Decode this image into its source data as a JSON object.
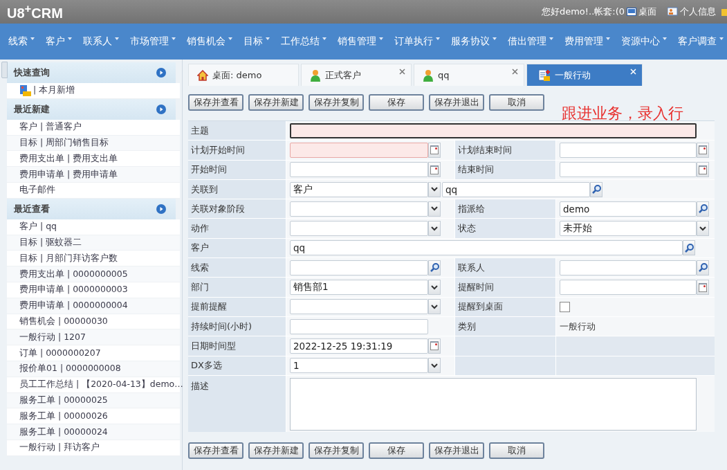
{
  "header": {
    "logo": "U8$^{+}$CRM",
    "greeting": "您好demo!..帐套:(0",
    "desktop_link": "桌面",
    "profile_link": "个人信息"
  },
  "nav": [
    "线索",
    "客户",
    "联系人",
    "市场管理",
    "销售机会",
    "目标",
    "工作总结",
    "销售管理",
    "订单执行",
    "服务协议",
    "借出管理",
    "费用管理",
    "资源中心",
    "客户调查"
  ],
  "sidebar": {
    "sections": [
      {
        "title": "快速查询",
        "items": [
          {
            "label": "| 本月新增",
            "kind": "icon"
          }
        ]
      },
      {
        "title": "最近新建",
        "items": [
          {
            "label": "客户 | 普通客户",
            "kind": "plain"
          },
          {
            "label": "目标 | 周部门销售目标",
            "kind": "plain"
          },
          {
            "label": "费用支出单 | 费用支出单",
            "kind": "plain"
          },
          {
            "label": "费用申请单 | 费用申请单",
            "kind": "plain"
          },
          {
            "label": "电子邮件",
            "kind": "plain"
          }
        ]
      },
      {
        "title": "最近查看",
        "items": [
          {
            "label": "客户 | qq",
            "kind": "plain"
          },
          {
            "label": "目标 | 驱蚊器二",
            "kind": "plain"
          },
          {
            "label": "目标 | 月部门拜访客户数",
            "kind": "plain"
          },
          {
            "label": "费用支出单 | 0000000005",
            "kind": "plain"
          },
          {
            "label": "费用申请单 | 0000000003",
            "kind": "plain"
          },
          {
            "label": "费用申请单 | 0000000004",
            "kind": "plain"
          },
          {
            "label": "销售机会 | 00000030",
            "kind": "plain"
          },
          {
            "label": "一般行动 | 1207",
            "kind": "plain"
          },
          {
            "label": "订单 | 0000000207",
            "kind": "plain"
          },
          {
            "label": "报价单01 | 0000000008",
            "kind": "plain"
          },
          {
            "label": "员工工作总结 | 【2020-04-13】demo…",
            "kind": "plain"
          },
          {
            "label": "服务工单 | 00000025",
            "kind": "plain"
          },
          {
            "label": "服务工单 | 00000026",
            "kind": "plain"
          },
          {
            "label": "服务工单 | 00000024",
            "kind": "plain"
          },
          {
            "label": "一般行动 | 拜访客户",
            "kind": "plain"
          }
        ]
      }
    ]
  },
  "tabs": [
    {
      "label": "桌面: demo",
      "kind": "home",
      "closable": false,
      "selected": false
    },
    {
      "label": "正式客户",
      "kind": "person",
      "closable": true,
      "selected": false
    },
    {
      "label": "qq",
      "kind": "person",
      "closable": true,
      "selected": false
    },
    {
      "label": "一般行动",
      "kind": "document",
      "closable": true,
      "selected": true
    }
  ],
  "toolbar_top": [
    "保存并查看",
    "保存并新建",
    "保存并复制",
    "保存",
    "保存并退出",
    "取消"
  ],
  "annotation": "跟进业务，录入行",
  "form": {
    "rows": [
      {
        "full": true,
        "cells": [
          {
            "label": "主题",
            "field": {
              "kind": "text",
              "invalid": true
            }
          }
        ]
      },
      {
        "full": false,
        "cells": [
          {
            "label": "计划开始时间",
            "field": {
              "kind": "date",
              "invalid": true
            }
          },
          {
            "label": "计划结束时间",
            "field": {
              "kind": "date",
              "invalid": false
            }
          }
        ]
      },
      {
        "full": false,
        "cells": [
          {
            "label": "开始时间",
            "field": {
              "kind": "date",
              "invalid": false
            }
          },
          {
            "label": "结束时间",
            "field": {
              "kind": "date",
              "invalid": false
            }
          }
        ]
      },
      {
        "full": true,
        "cells": [
          {
            "label": "关联到",
            "field": {
              "kind": "select_search",
              "value": "客户",
              "search_value": "qq",
              "invalid": false
            }
          }
        ]
      },
      {
        "full": false,
        "cells": [
          {
            "label": "关联对象阶段",
            "field": {
              "kind": "select",
              "invalid": false
            }
          },
          {
            "label": "指派给",
            "field": {
              "kind": "search",
              "value": "demo",
              "invalid": false
            }
          }
        ]
      },
      {
        "full": false,
        "cells": [
          {
            "label": "动作",
            "field": {
              "kind": "select",
              "invalid": false
            }
          },
          {
            "label": "状态",
            "field": {
              "kind": "select",
              "value": "未开始",
              "invalid": false
            }
          }
        ]
      },
      {
        "full": true,
        "cells": [
          {
            "label": "客户",
            "field": {
              "kind": "search",
              "value": "qq",
              "invalid": false
            }
          }
        ]
      },
      {
        "full": false,
        "cells": [
          {
            "label": "线索",
            "field": {
              "kind": "search",
              "invalid": false
            }
          },
          {
            "label": "联系人",
            "field": {
              "kind": "search",
              "invalid": false
            }
          }
        ]
      },
      {
        "full": false,
        "cells": [
          {
            "label": "部门",
            "field": {
              "kind": "select",
              "value": "销售部1",
              "invalid": false
            }
          },
          {
            "label": "提醒时间",
            "field": {
              "kind": "date",
              "invalid": false
            }
          }
        ]
      },
      {
        "full": false,
        "cells": [
          {
            "label": "提前提醒",
            "field": {
              "kind": "select",
              "invalid": false
            }
          },
          {
            "label": "提醒到桌面",
            "field": {
              "kind": "checkbox",
              "checked": false
            }
          }
        ]
      },
      {
        "full": false,
        "cells": [
          {
            "label": "持续时间(小时)",
            "field": {
              "kind": "text",
              "invalid": false
            }
          },
          {
            "label": "类别",
            "field": {
              "kind": "static",
              "value": "一般行动"
            }
          }
        ]
      },
      {
        "full": false,
        "cells": [
          {
            "label": "日期时间型",
            "field": {
              "kind": "date",
              "value": "2022-12-25 19:31:19",
              "invalid": false
            }
          }
        ]
      },
      {
        "full": false,
        "cells": [
          {
            "label": "DX多选",
            "field": {
              "kind": "select",
              "value": "1",
              "invalid": false
            }
          }
        ]
      },
      {
        "full": true,
        "cells": [
          {
            "label": "描述",
            "field": {
              "kind": "textarea",
              "invalid": false
            }
          }
        ]
      }
    ]
  },
  "toolbar_bottom": [
    "保存并查看",
    "保存并新建",
    "保存并复制",
    "保存",
    "保存并退出",
    "取消"
  ]
}
